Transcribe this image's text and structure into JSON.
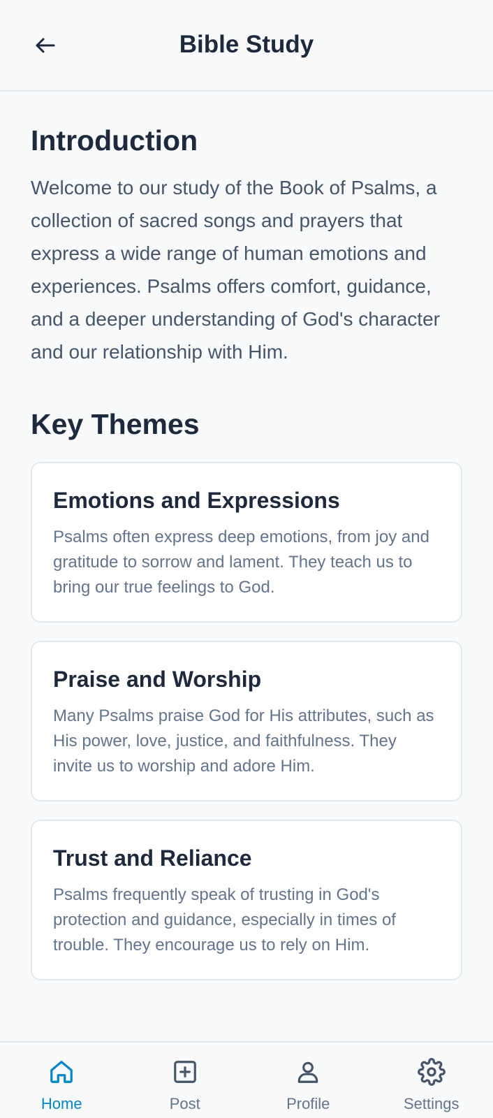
{
  "header": {
    "title": "Bible Study",
    "back_icon": "arrow-left-icon"
  },
  "intro": {
    "title": "Introduction",
    "text": "Welcome to our study of the Book of Psalms, a collection of sacred songs and prayers that express a wide range of human emotions and experiences. Psalms offers comfort, guidance, and a deeper understanding of God's character and our relationship with Him."
  },
  "themes": {
    "title": "Key Themes",
    "cards": [
      {
        "title": "Emotions and Expressions",
        "text": "Psalms often express deep emotions, from joy and gratitude to sorrow and lament. They teach us to bring our true feelings to God."
      },
      {
        "title": "Praise and Worship",
        "text": "Many Psalms praise God for His attributes, such as His power, love, justice, and faithfulness. They invite us to worship and adore Him."
      },
      {
        "title": "Trust and Reliance",
        "text": "Psalms frequently speak of trusting in God's protection and guidance, especially in times of trouble. They encourage us to rely on Him."
      }
    ]
  },
  "nav": {
    "items": [
      {
        "label": "Home",
        "icon": "home-icon",
        "active": true
      },
      {
        "label": "Post",
        "icon": "plus-square-icon",
        "active": false
      },
      {
        "label": "Profile",
        "icon": "user-icon",
        "active": false
      },
      {
        "label": "Settings",
        "icon": "gear-icon",
        "active": false
      }
    ]
  },
  "colors": {
    "accent": "#0284c7",
    "text_primary": "#1e293b",
    "text_secondary": "#64748b",
    "background": "#f8fafc"
  }
}
